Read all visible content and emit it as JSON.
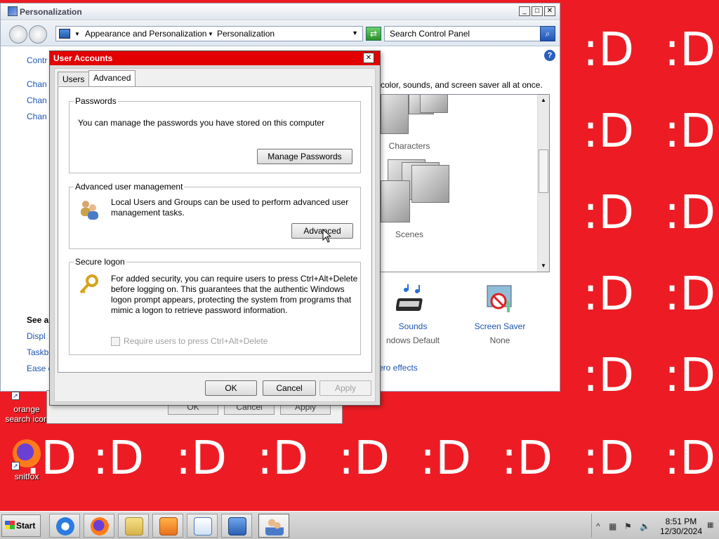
{
  "wallpaper": {
    "smiley": ":D",
    "background": "#ed1c24",
    "text_color": "#ffffff"
  },
  "desktop_icons": [
    {
      "label": "orange search icon"
    },
    {
      "label": "snitfox"
    }
  ],
  "personalization_window": {
    "title": "Personalization",
    "address": {
      "crumb1": "Appearance and Personalization",
      "sep": "▶",
      "crumb2": "Personalization"
    },
    "search_placeholder": "Search Control Panel",
    "left_nav": [
      "Contr",
      "Chan",
      "Chan",
      "Chan"
    ],
    "see_also": {
      "heading": "See a",
      "links": [
        "Displ",
        "Taskb",
        "Ease c"
      ]
    },
    "intro_text": "color, sounds, and screen saver all at once.",
    "themes": [
      "Characters",
      "Scenes"
    ],
    "sounds": {
      "label": "Sounds",
      "value": "ndows Default"
    },
    "screen_saver": {
      "label": "Screen Saver",
      "value": "None"
    },
    "aero_link": "ero effects"
  },
  "behind_dialog": {
    "buttons": [
      "OK",
      "Cancel",
      "Apply"
    ]
  },
  "user_accounts_dialog": {
    "title": "User Accounts",
    "tabs": [
      "Users",
      "Advanced"
    ],
    "active_tab": "Advanced",
    "passwords": {
      "heading": "Passwords",
      "text": "You can manage the passwords you have stored on this computer",
      "button": "Manage Passwords"
    },
    "advanced_mgmt": {
      "heading": "Advanced user management",
      "text": "Local Users and Groups can be used to perform advanced user management tasks.",
      "button": "Advanced"
    },
    "secure_logon": {
      "heading": "Secure logon",
      "text": "For added security, you can require users to press Ctrl+Alt+Delete before logging on. This guarantees that the authentic Windows logon prompt appears, protecting the system from programs that mimic a logon to retrieve password information.",
      "checkbox_label": "Require users to press Ctrl+Alt+Delete",
      "checked": false
    },
    "buttons": {
      "ok": "OK",
      "cancel": "Cancel",
      "apply": "Apply"
    }
  },
  "taskbar": {
    "start_label": "Start",
    "pinned": [
      "internet-explorer",
      "firefox",
      "windows-explorer",
      "media-player",
      "control-panel-tasks",
      "control-panel",
      "user-accounts"
    ],
    "clock": {
      "time": "8:51 PM",
      "date": "12/30/2024"
    }
  }
}
